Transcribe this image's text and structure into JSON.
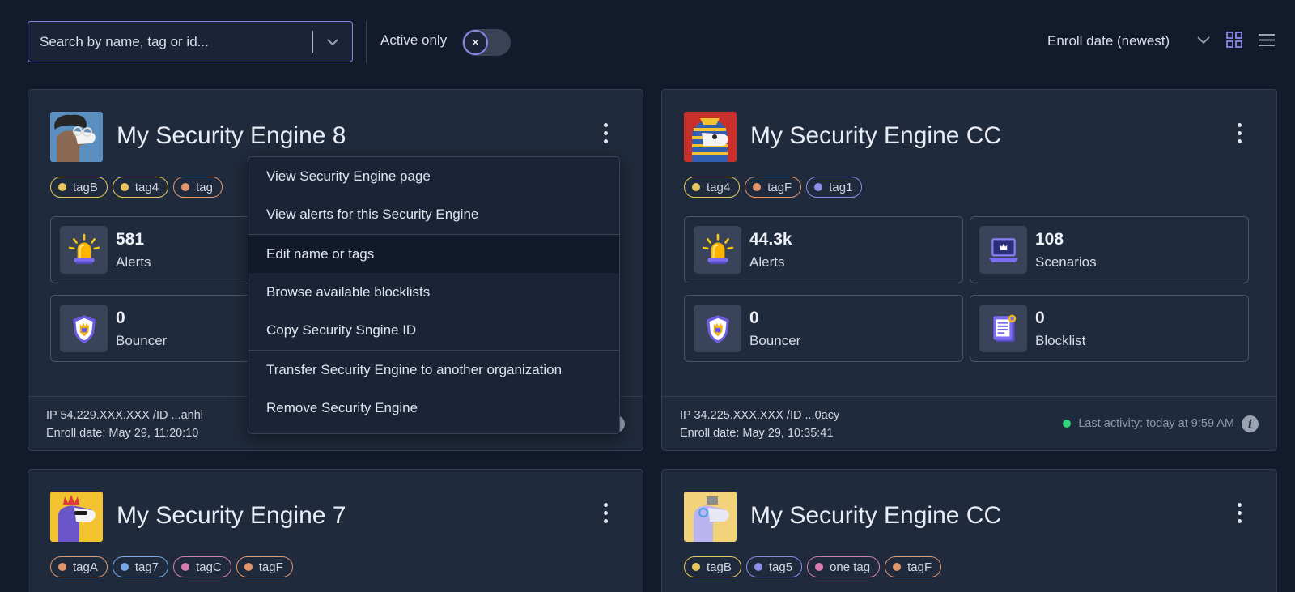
{
  "toolbar": {
    "search_placeholder": "Search by name, tag or id...",
    "active_only_label": "Active only",
    "toggle_symbol": "✕",
    "sort_label": "Enroll date (newest)"
  },
  "colors": {
    "accent": "#8a86e6",
    "card_bg": "#1f2a3c",
    "page_bg": "#131a2b",
    "online": "#2fd27b"
  },
  "cards": [
    {
      "title": "My Security Engine 8",
      "tags": [
        {
          "label": "tagB",
          "color": "#e6c65a"
        },
        {
          "label": "tag4",
          "color": "#e6c65a"
        },
        {
          "label": "tag",
          "color": "#e0956a"
        }
      ],
      "stats": [
        {
          "value": "581",
          "label": "Alerts",
          "icon": "siren-icon"
        },
        {
          "value": "0",
          "label": "Bouncer",
          "icon": "shield-icon"
        }
      ],
      "footer": {
        "ip": "IP 54.229.XXX.XXX /ID ...anhl",
        "enroll": "Enroll date: May 29, 11:20:10"
      }
    },
    {
      "title": "My Security Engine CC",
      "tags": [
        {
          "label": "tag4",
          "color": "#e6c65a"
        },
        {
          "label": "tagF",
          "color": "#e0956a"
        },
        {
          "label": "tag1",
          "color": "#8f8de8"
        }
      ],
      "stats": [
        {
          "value": "44.3k",
          "label": "Alerts",
          "icon": "siren-icon"
        },
        {
          "value": "108",
          "label": "Scenarios",
          "icon": "laptop-icon"
        },
        {
          "value": "0",
          "label": "Bouncer",
          "icon": "shield-icon"
        },
        {
          "value": "0",
          "label": "Blocklist",
          "icon": "blocklist-icon"
        }
      ],
      "footer": {
        "ip": "IP 34.225.XXX.XXX /ID ...0acy",
        "enroll": "Enroll date: May 29, 10:35:41",
        "activity": "Last activity: today at 9:59 AM"
      }
    },
    {
      "title": "My Security Engine 7",
      "tags": [
        {
          "label": "tagA",
          "color": "#e0956a"
        },
        {
          "label": "tag7",
          "color": "#7aa7e8"
        },
        {
          "label": "tagC",
          "color": "#d77bb0"
        },
        {
          "label": "tagF",
          "color": "#e0956a"
        }
      ]
    },
    {
      "title": "My Security Engine CC",
      "tags": [
        {
          "label": "tagB",
          "color": "#e6c65a"
        },
        {
          "label": "tag5",
          "color": "#8f8de8"
        },
        {
          "label": "one tag",
          "color": "#d77bb0"
        },
        {
          "label": "tagF",
          "color": "#e0956a"
        }
      ]
    }
  ],
  "menu": {
    "items": [
      "View Security Engine page",
      "View alerts for this Security Engine",
      "Edit name or tags",
      "Browse available blocklists",
      "Copy Security Sngine ID",
      "Transfer Security Engine to another organization",
      "Remove Security Engine"
    ],
    "highlighted_index": 2
  },
  "info_symbol": "i"
}
